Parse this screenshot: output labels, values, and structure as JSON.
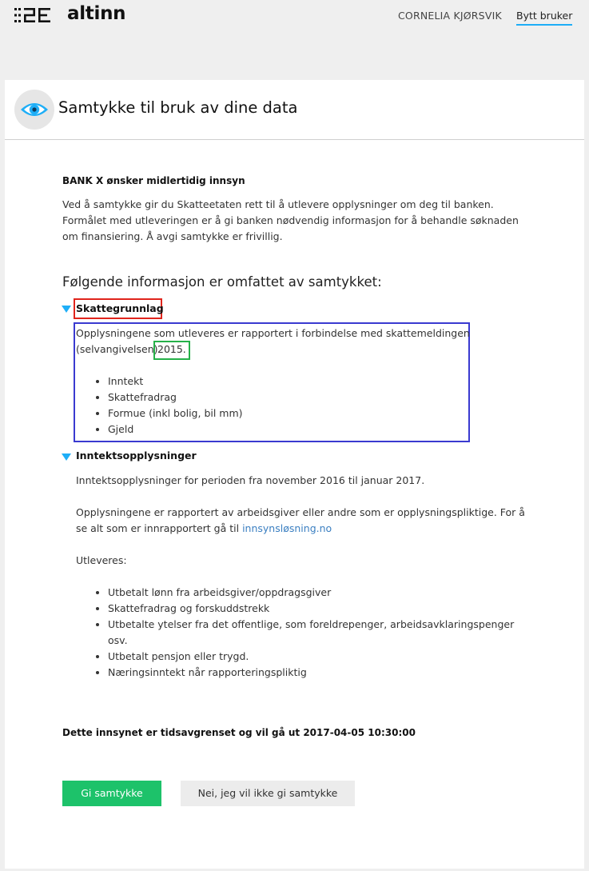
{
  "header": {
    "logo_text": "altinn",
    "user_name": "CORNELIA KJØRSVIK",
    "switch_user": "Bytt bruker"
  },
  "panel": {
    "title": "Samtykke til bruk av dine data",
    "icon": "eye-icon"
  },
  "request": {
    "heading": "BANK X  ønsker midlertidig innsyn",
    "description_lines": [
      "Ved å samtykke gir du Skatteetaten rett til å utlevere opplysninger om deg til banken.",
      "Formålet med utleveringen er å gi banken nødvendig informasjon for å behandle søknaden",
      "om finansiering. Å avgi samtykke er frivillig."
    ]
  },
  "info_heading": "Følgende informasjon er omfattet av samtykket:",
  "sections": [
    {
      "title": "Skattegrunnlag",
      "text_line1": "Opplysningene som utleveres er rapportert i forbindelse med skattemeldingen",
      "text_line2_prefix": "(selvangivelsen)",
      "year": "2015.",
      "items": [
        "Inntekt",
        "Skattefradrag",
        "Formue (inkl bolig, bil mm)",
        "Gjeld"
      ]
    },
    {
      "title": "Inntektsopplysninger",
      "period_text": "Inntektsopplysninger for perioden fra november 2016 til januar 2017.",
      "reported_line1": "Opplysningene er rapportert av arbeidsgiver eller andre som er opplysningspliktige. For å",
      "reported_line2_prefix": "se alt som er innrapportert gå til",
      "link": "innsynsløsning.no",
      "utleveres_label": "Utleveres:",
      "items": [
        "Utbetalt lønn fra arbeidsgiver/oppdragsgiver",
        "Skattefradrag og forskuddstrekk",
        "Utbetalte ytelser fra det offentlige, som foreldrepenger, arbeidsavklaringspenger",
        "osv.",
        "Utbetalt pensjon eller trygd.",
        "Næringsinntekt når rapporteringspliktig"
      ]
    }
  ],
  "expiry_text": "Dette innsynet er tidsavgrenset og vil gå ut 2017-04-05 10:30:00",
  "buttons": {
    "accept": "Gi samtykke",
    "decline": "Nei, jeg vil ikke gi samtykke"
  },
  "colors": {
    "accent": "#1eaef7",
    "accept_button": "#1dc26a",
    "annotation_red": "#e0241c",
    "annotation_blue": "#3a3ad0",
    "annotation_green": "#26b149"
  }
}
